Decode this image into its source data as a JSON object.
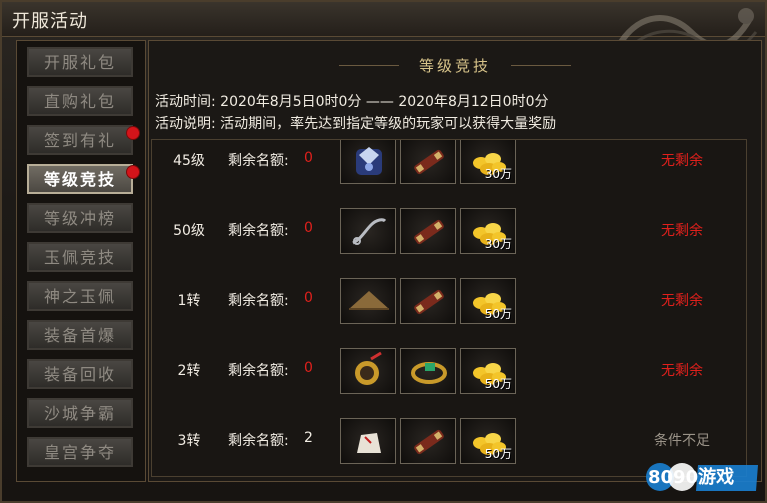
{
  "window": {
    "title": "开服活动"
  },
  "sidebar": {
    "items": [
      {
        "label": "开服礼包",
        "active": false,
        "dot": false
      },
      {
        "label": "直购礼包",
        "active": false,
        "dot": false
      },
      {
        "label": "签到有礼",
        "active": false,
        "dot": true
      },
      {
        "label": "等级竞技",
        "active": true,
        "dot": true
      },
      {
        "label": "等级冲榜",
        "active": false,
        "dot": false
      },
      {
        "label": "玉佩竞技",
        "active": false,
        "dot": false
      },
      {
        "label": "神之玉佩",
        "active": false,
        "dot": false
      },
      {
        "label": "装备首爆",
        "active": false,
        "dot": false
      },
      {
        "label": "装备回收",
        "active": false,
        "dot": false
      },
      {
        "label": "沙城争霸",
        "active": false,
        "dot": false
      },
      {
        "label": "皇宫争夺",
        "active": false,
        "dot": false
      }
    ]
  },
  "panel": {
    "header": "等级竞技",
    "time_label": "活动时间: 2020年8月5日0时0分  ——  2020年8月12日0时0分",
    "desc_label": "活动说明: 活动期间，率先达到指定等级的玩家可以获得大量奖励",
    "quota_label": "剩余名额:",
    "rows": [
      {
        "level": "45级",
        "quota": "0",
        "rewards": [
          {
            "icon": "blue-gem-pouch-icon",
            "qty": ""
          },
          {
            "icon": "scroll-icon",
            "qty": ""
          },
          {
            "icon": "gold-coins-icon",
            "qty": "30万"
          }
        ],
        "status": "无剩余",
        "status_kind": "none"
      },
      {
        "level": "50级",
        "quota": "0",
        "rewards": [
          {
            "icon": "chain-weapon-icon",
            "qty": ""
          },
          {
            "icon": "scroll-icon",
            "qty": ""
          },
          {
            "icon": "gold-coins-icon",
            "qty": "30万"
          }
        ],
        "status": "无剩余",
        "status_kind": "none"
      },
      {
        "level": "1转",
        "quota": "0",
        "rewards": [
          {
            "icon": "straw-hat-icon",
            "qty": ""
          },
          {
            "icon": "scroll-icon",
            "qty": ""
          },
          {
            "icon": "gold-coins-icon",
            "qty": "50万"
          }
        ],
        "status": "无剩余",
        "status_kind": "none"
      },
      {
        "level": "2转",
        "quota": "0",
        "rewards": [
          {
            "icon": "medal-icon",
            "qty": ""
          },
          {
            "icon": "jade-bracelet-icon",
            "qty": ""
          },
          {
            "icon": "gold-coins-icon",
            "qty": "50万"
          }
        ],
        "status": "无剩余",
        "status_kind": "none"
      },
      {
        "level": "3转",
        "quota": "2",
        "rewards": [
          {
            "icon": "cloth-bag-icon",
            "qty": ""
          },
          {
            "icon": "scroll-icon",
            "qty": ""
          },
          {
            "icon": "gold-coins-icon",
            "qty": "50万"
          }
        ],
        "status": "条件不足",
        "status_kind": "unmet"
      }
    ]
  },
  "watermark": {
    "text": "8090游戏"
  },
  "colors": {
    "red": "#e0201c",
    "muted": "#9a9388",
    "gold": "#f3c52a"
  }
}
